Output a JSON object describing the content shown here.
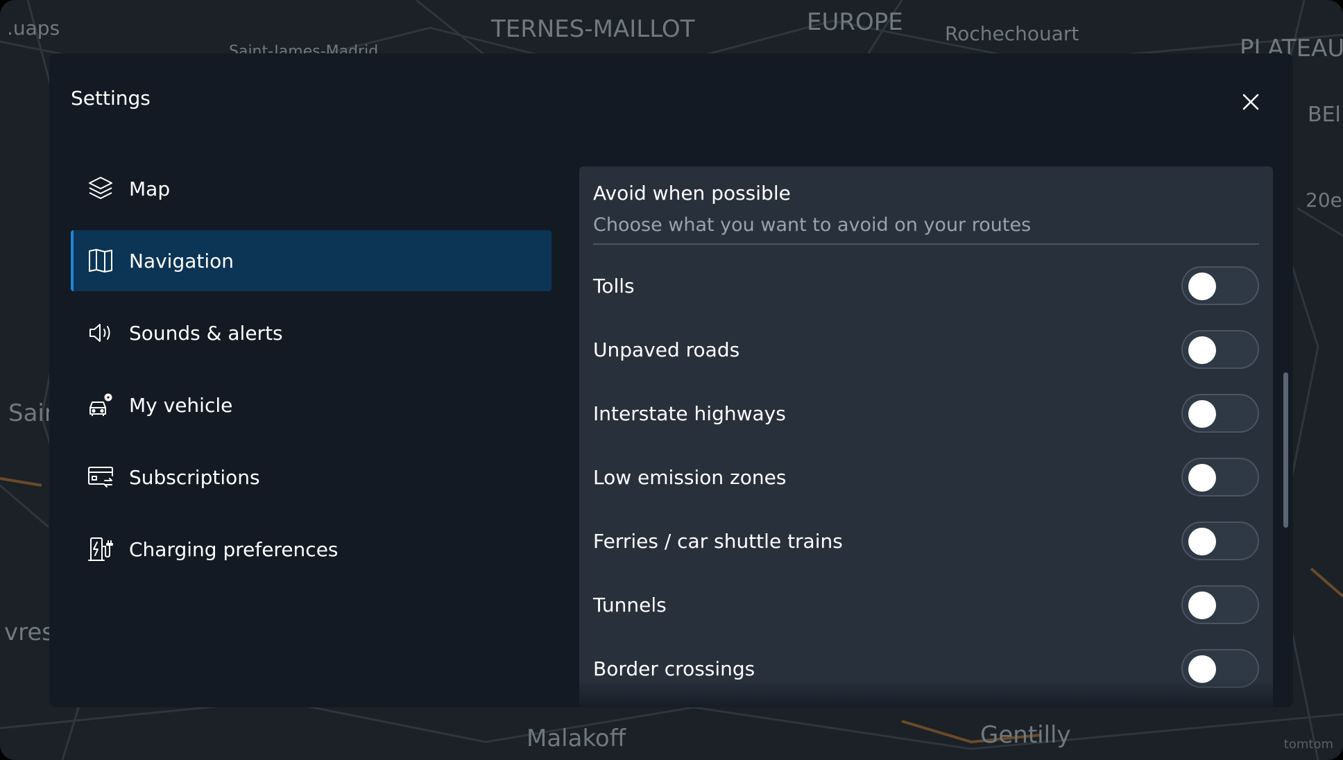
{
  "map": {
    "labels": [
      "TERNES-MAILLOT",
      "EUROPE",
      "Rochechouart",
      "PLATEAU",
      ".uaps",
      "Saint-James-Madrid",
      "BEl",
      "20e",
      "Sain",
      "vres",
      "Malakoff",
      "Gentilly"
    ],
    "watermark": "tomtom"
  },
  "dialog": {
    "title": "Settings",
    "close_icon": "close-icon"
  },
  "sidebar": {
    "items": [
      {
        "label": "Map",
        "icon": "layers-icon"
      },
      {
        "label": "Navigation",
        "icon": "map-icon"
      },
      {
        "label": "Sounds & alerts",
        "icon": "speaker-icon"
      },
      {
        "label": "My vehicle",
        "icon": "car-settings-icon"
      },
      {
        "label": "Subscriptions",
        "icon": "subscription-card-icon"
      },
      {
        "label": "Charging preferences",
        "icon": "charging-station-icon"
      }
    ],
    "active_index": 1
  },
  "panel": {
    "title": "Avoid when possible",
    "subtitle": "Choose what you want to avoid on your routes",
    "options": [
      {
        "label": "Tolls",
        "enabled": false
      },
      {
        "label": "Unpaved roads",
        "enabled": false
      },
      {
        "label": "Interstate highways",
        "enabled": false
      },
      {
        "label": "Low emission zones",
        "enabled": false
      },
      {
        "label": "Ferries / car shuttle trains",
        "enabled": false
      },
      {
        "label": "Tunnels",
        "enabled": false
      },
      {
        "label": "Border crossings",
        "enabled": false
      }
    ]
  },
  "colors": {
    "dialog_bg": "#131a24",
    "panel_bg": "#28303b",
    "active_item_bg": "#0c3454",
    "accent": "#1f86d6"
  }
}
